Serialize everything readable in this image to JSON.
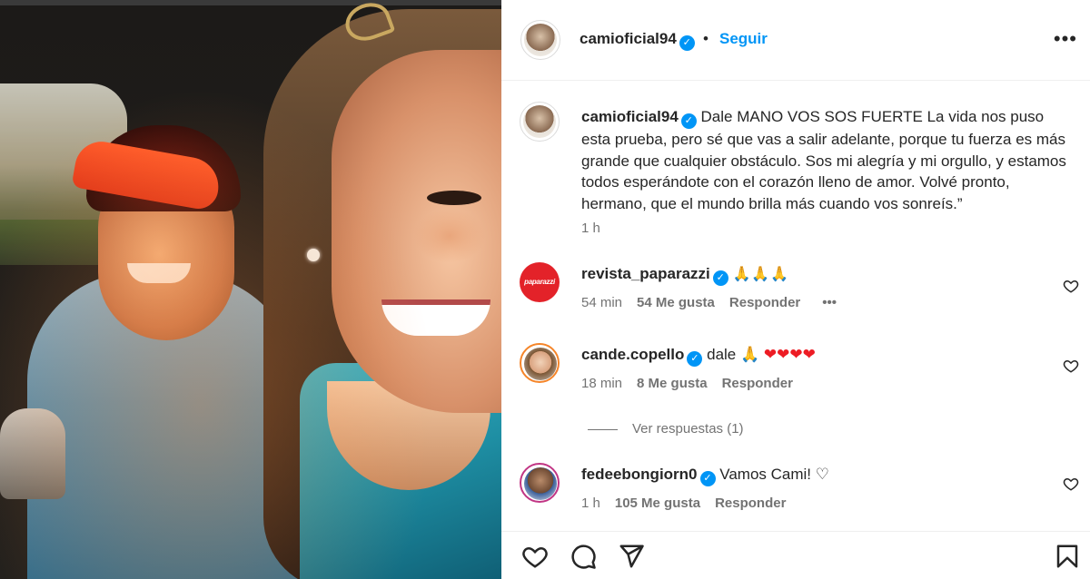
{
  "post": {
    "author": "camioficial94",
    "follow_label": "Seguir",
    "separator": "•",
    "more_label": "•••"
  },
  "caption": {
    "author": "camioficial94",
    "text": "Dale MANO VOS SOS FUERTE La vida nos puso esta prueba, pero sé que vas a salir adelante, porque tu fuerza es más grande que cualquier obstáculo. Sos mi alegría y mi orgullo, y estamos todos esperándote con el corazón lleno de amor. Volvé pronto, hermano, que el mundo brilla más cuando vos sonreís.”",
    "time": "1 h"
  },
  "comments": [
    {
      "user": "revista_paparazzi",
      "avatar_text": "paparazzi",
      "text": "🙏🙏🙏",
      "time": "54 min",
      "likes": "54 Me gusta",
      "reply_label": "Responder",
      "more_label": "•••"
    },
    {
      "user": "cande.copello",
      "text": "dale 🙏 ",
      "hearts": "❤❤❤❤",
      "time": "18 min",
      "likes": "8 Me gusta",
      "reply_label": "Responder"
    },
    {
      "user": "fedeebongiorn0",
      "text": "Vamos Cami! ♡",
      "time": "1 h",
      "likes": "105 Me gusta",
      "reply_label": "Responder"
    }
  ],
  "view_replies": "Ver respuestas (1)",
  "icons": {
    "verified": "verified-badge-icon",
    "like": "heart-icon",
    "comment": "comment-icon",
    "share": "send-icon",
    "save": "bookmark-icon"
  },
  "colors": {
    "accent": "#0095f6",
    "secondary_text": "#737373",
    "heart_red": "#ed1c24"
  }
}
